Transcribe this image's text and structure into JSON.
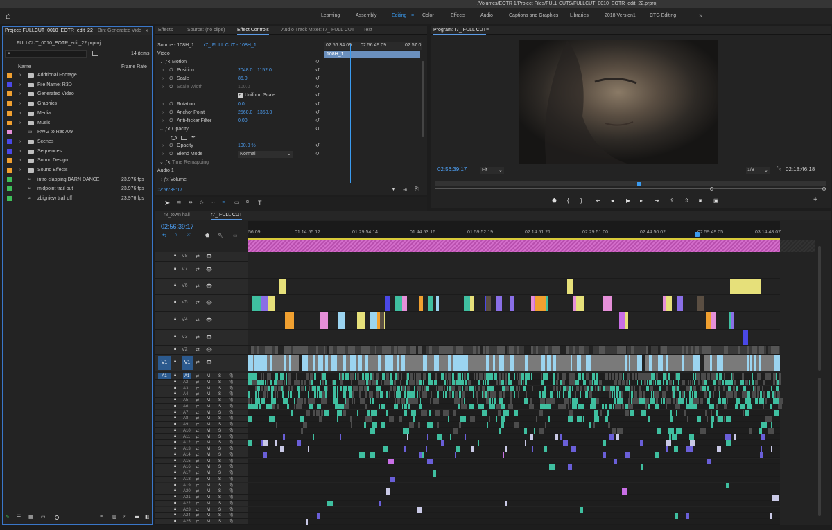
{
  "titlebar": {
    "path": "/Volumes/EOTR 1/Project Files/FULL CUTS/FULLCUT_0010_EOTR_edit_22.prproj"
  },
  "workspaces": [
    {
      "label": "Learning",
      "active": false
    },
    {
      "label": "Assembly",
      "active": false
    },
    {
      "label": "Editing",
      "active": true
    },
    {
      "label": "Color",
      "active": false
    },
    {
      "label": "Effects",
      "active": false
    },
    {
      "label": "Audio",
      "active": false
    },
    {
      "label": "Captions and Graphics",
      "active": false
    },
    {
      "label": "Libraries",
      "active": false
    },
    {
      "label": "2018 Version1",
      "active": false
    },
    {
      "label": "CTG Editing",
      "active": false
    }
  ],
  "project": {
    "tab_project": "Project: FULLCUT_0010_EOTR_edit_22",
    "tab_bin": "Bin: Generated Vide",
    "file": "FULLCUT_0010_EOTR_edit_22.prproj",
    "item_count": "14 items",
    "col_name": "Name",
    "col_rate": "Frame Rate",
    "items": [
      {
        "name": "Addtional Footage",
        "color": "#f0a030",
        "type": "folder",
        "rate": ""
      },
      {
        "name": "File Name: R3D",
        "color": "#4a48e6",
        "type": "folder",
        "rate": ""
      },
      {
        "name": "Generated Video",
        "color": "#f0a030",
        "type": "folder",
        "rate": ""
      },
      {
        "name": "Graphics",
        "color": "#f0a030",
        "type": "folder",
        "rate": ""
      },
      {
        "name": "Media",
        "color": "#f0a030",
        "type": "folder",
        "rate": ""
      },
      {
        "name": "Music",
        "color": "#f0a030",
        "type": "folder",
        "rate": ""
      },
      {
        "name": "RWG to Rec709",
        "color": "#e58fd8",
        "type": "file",
        "rate": ""
      },
      {
        "name": "Scenes",
        "color": "#4a48e6",
        "type": "folder",
        "rate": ""
      },
      {
        "name": "Sequences",
        "color": "#4a48e6",
        "type": "folder",
        "rate": ""
      },
      {
        "name": "Sound Design",
        "color": "#f0a030",
        "type": "folder",
        "rate": ""
      },
      {
        "name": "Sound Effects",
        "color": "#f0a030",
        "type": "folder",
        "rate": ""
      },
      {
        "name": "intro clapping BARN DANCE",
        "color": "#3fbf5a",
        "type": "audio",
        "rate": "23.976 fps"
      },
      {
        "name": "midpoint trail out",
        "color": "#3fbf5a",
        "type": "audio",
        "rate": "23.976 fps"
      },
      {
        "name": "zbigniew trail off",
        "color": "#3fbf5a",
        "type": "audio",
        "rate": "23.976 fps"
      }
    ]
  },
  "effect_tabs": [
    "Effects",
    "Source: (no clips)",
    "Effect Controls",
    "Audio Track Mixer: r7_ FULL CUT",
    "Text"
  ],
  "effect_controls": {
    "source": "Source - 108H_1",
    "sequence": "r7_ FULL CUT - 108H_1",
    "times": [
      "02:56:34:09",
      "02:56:49:09",
      "02:57:0"
    ],
    "clip": "108H_1",
    "video_label": "Video",
    "audio_label": "Audio 1",
    "timecode": "02:56:39:17",
    "rows": [
      {
        "name": "Motion",
        "v1": "",
        "v2": "",
        "fx": true
      },
      {
        "name": "Position",
        "v1": "2048.0",
        "v2": "1152.0",
        "fx": false
      },
      {
        "name": "Scale",
        "v1": "86.0",
        "v2": "",
        "fx": false
      },
      {
        "name": "Scale Width",
        "v1": "100.0",
        "v2": "",
        "fx": false,
        "dim": true
      },
      {
        "name": "",
        "v1": "Uniform Scale",
        "v2": "",
        "fx": false,
        "check": true
      },
      {
        "name": "Rotation",
        "v1": "0.0",
        "v2": "",
        "fx": false
      },
      {
        "name": "Anchor Point",
        "v1": "2560.0",
        "v2": "1350.0",
        "fx": false
      },
      {
        "name": "Anti-flicker Filter",
        "v1": "0.00",
        "v2": "",
        "fx": false
      },
      {
        "name": "Opacity",
        "v1": "",
        "v2": "",
        "fx": true
      },
      {
        "name": "",
        "v1": "",
        "v2": "",
        "fx": false,
        "shapes": true
      },
      {
        "name": "Opacity",
        "v1": "100.0 %",
        "v2": "",
        "fx": false
      },
      {
        "name": "Blend Mode",
        "v1": "Normal",
        "v2": "",
        "fx": false,
        "select": true
      },
      {
        "name": "Time Remapping",
        "v1": "",
        "v2": "",
        "fx": true,
        "dim": true
      }
    ],
    "volume_label": "Volume"
  },
  "program": {
    "tab": "Program: r7_ FULL CUT",
    "timecode": "02:56:39:17",
    "fit": "Fit",
    "res": "1/8",
    "duration": "02:18:46:18"
  },
  "timeline": {
    "tabs": [
      "r8_town hall",
      "r7_ FULL CUT"
    ],
    "timecode": "02:56:39:17",
    "ruler": [
      "56:09",
      "01:14:55:12",
      "01:29:54:14",
      "01:44:53:16",
      "01:59:52:19",
      "02:14:51:21",
      "02:29:51:00",
      "02:44:50:02",
      "02:59:49:05",
      "03:14:48:07"
    ],
    "video_tracks": [
      "V8",
      "V7",
      "V6",
      "V5",
      "V4",
      "V3",
      "V2",
      "V1"
    ],
    "audio_tracks": [
      "A1",
      "A2",
      "A3",
      "A4",
      "A5",
      "A6",
      "A7",
      "A8",
      "A9",
      "A10",
      "A11",
      "A12",
      "A13",
      "A14",
      "A15",
      "A16",
      "A17",
      "A18",
      "A19",
      "A20",
      "A21",
      "A22",
      "A23",
      "A24",
      "A25"
    ],
    "v1_src": "V1",
    "a1_src": "A1",
    "m_label": "M",
    "s_label": "S"
  },
  "colors": {
    "accent": "#3a9bf0",
    "pink": "#e58fd8",
    "violet": "#8a6fe6",
    "yellow": "#e6e07a",
    "teal": "#3fbfa0",
    "orange": "#f0a030"
  }
}
